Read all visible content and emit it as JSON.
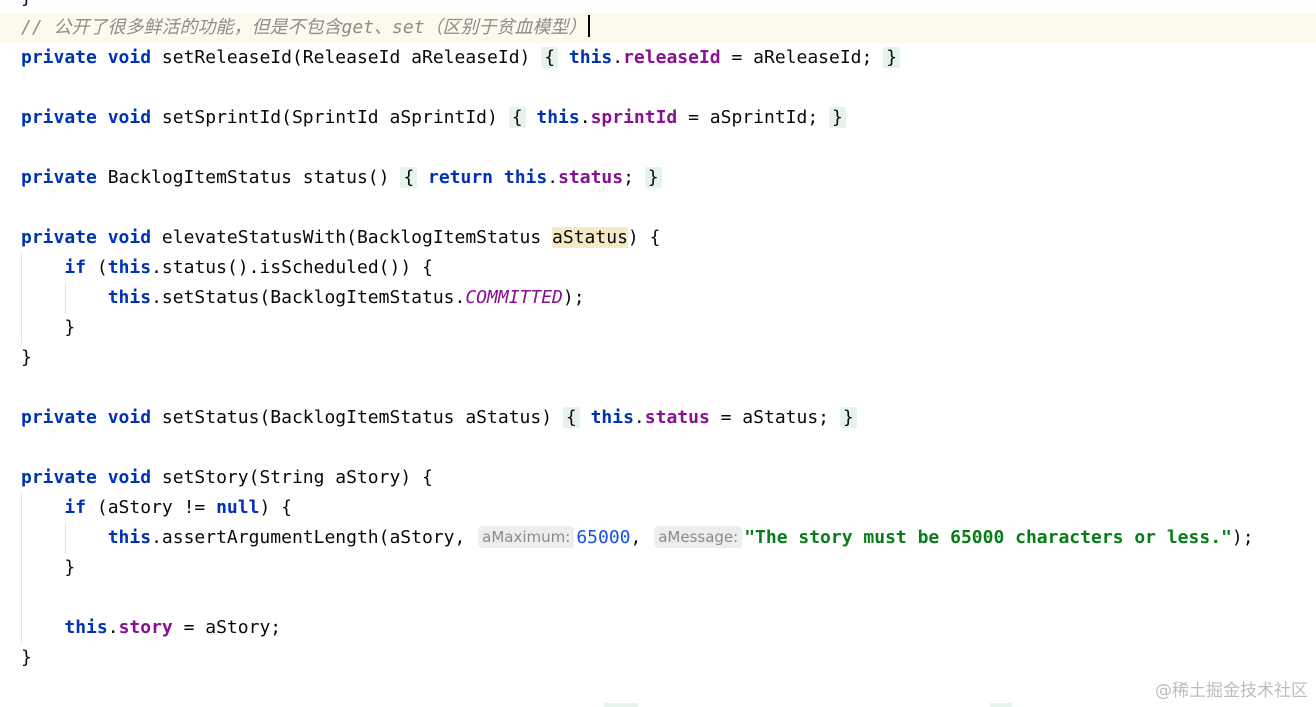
{
  "editor": {
    "top_brace": "}",
    "comment": "// 公开了很多鲜活的功能，但是不包含get、set（区别于贫血模型）",
    "kw_private": "private",
    "kw_void": "void",
    "kw_this": "this",
    "kw_return": "return",
    "kw_if": "if",
    "kw_null": "null",
    "m1": {
      "sig": "setReleaseId(ReleaseId aReleaseId) ",
      "open": "{",
      "field": "releaseId",
      "assign": " = aReleaseId; ",
      "close": "}"
    },
    "m2": {
      "sig": "setSprintId(SprintId aSprintId) ",
      "open": "{",
      "field": "sprintId",
      "assign": " = aSprintId; ",
      "close": "}"
    },
    "m3": {
      "type": "BacklogItemStatus status() ",
      "open": "{",
      "field": "status",
      "end": "; ",
      "close": "}"
    },
    "m4": {
      "sig": "elevateStatusWith(BacklogItemStatus ",
      "param": "aStatus",
      "sig_end": ") {",
      "if_cond": " (",
      "if_rest": ".status().isScheduled()) {",
      "call": ".setStatus(BacklogItemStatus.",
      "const": "COMMITTED",
      "call_end": ");",
      "inner_close": "}",
      "close": "}"
    },
    "m5": {
      "sig": "setStatus(BacklogItemStatus aStatus) ",
      "open": "{",
      "field": "status",
      "assign": " = aStatus; ",
      "close": "}"
    },
    "m6": {
      "sig": "setStory(String aStory) {",
      "if_open": " (aStory != ",
      "if_close": ") {",
      "call": ".assertArgumentLength(aStory, ",
      "hint1": "aMaximum:",
      "num": "65000",
      "comma": ", ",
      "hint2": "aMessage:",
      "str": "\"The story must be 65000 characters or less.\"",
      "call_end": ");",
      "inner_close": "}",
      "field": "story",
      "assign": " = aStory;",
      "close": "}"
    }
  },
  "watermark": "@稀土掘金技术社区"
}
